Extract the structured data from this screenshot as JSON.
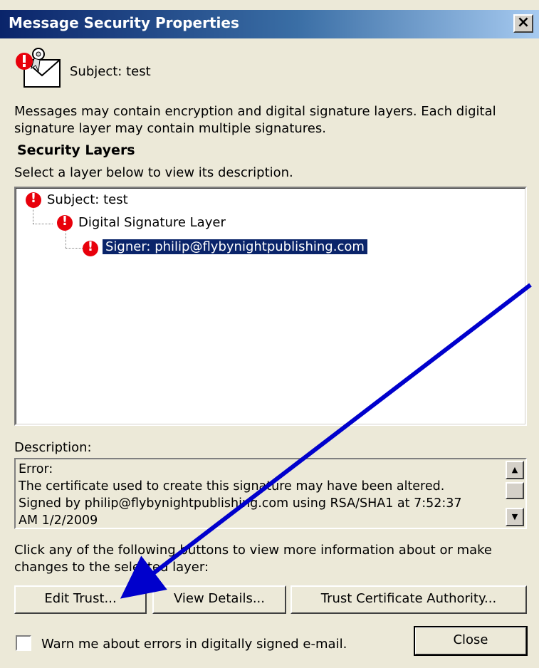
{
  "window": {
    "title": "Message Security Properties",
    "close_glyph": "×"
  },
  "header": {
    "subject_label": "Subject:  test",
    "icon": "envelope-error-icon"
  },
  "intro": {
    "line1": "Messages may contain encryption and digital signature layers. Each digital",
    "line2": "signature layer may contain multiple signatures."
  },
  "security_layers": {
    "heading": "Security Layers",
    "instruction": "Select a layer below to view its description.",
    "tree": [
      {
        "label": "Subject: test",
        "icon": "error-icon",
        "selected": false
      },
      {
        "label": "Digital Signature Layer",
        "icon": "error-icon",
        "selected": false
      },
      {
        "label": "Signer: philip@flybynightpublishing.com",
        "icon": "error-icon",
        "selected": true
      }
    ]
  },
  "description": {
    "label": "Description:",
    "lines": [
      "Error:",
      "The certificate used to create this signature may have been altered.",
      "Signed by philip@flybynightpublishing.com using RSA/SHA1 at 7:52:37",
      "AM 1/2/2009"
    ]
  },
  "actions": {
    "info_line1": "Click any of the following buttons to view more information about or make",
    "info_line2": "changes to the selected layer:",
    "edit_trust": "Edit Trust...",
    "view_details": "View Details...",
    "trust_ca": "Trust Certificate Authority..."
  },
  "footer": {
    "warn_label": "Warn me about errors in digitally signed e-mail.",
    "warn_checked": false,
    "close": "Close"
  },
  "colors": {
    "selection": "#0a246a",
    "error": "#e8000b",
    "annotation_arrow": "#0000cc",
    "dialog_bg": "#ece9d8"
  }
}
